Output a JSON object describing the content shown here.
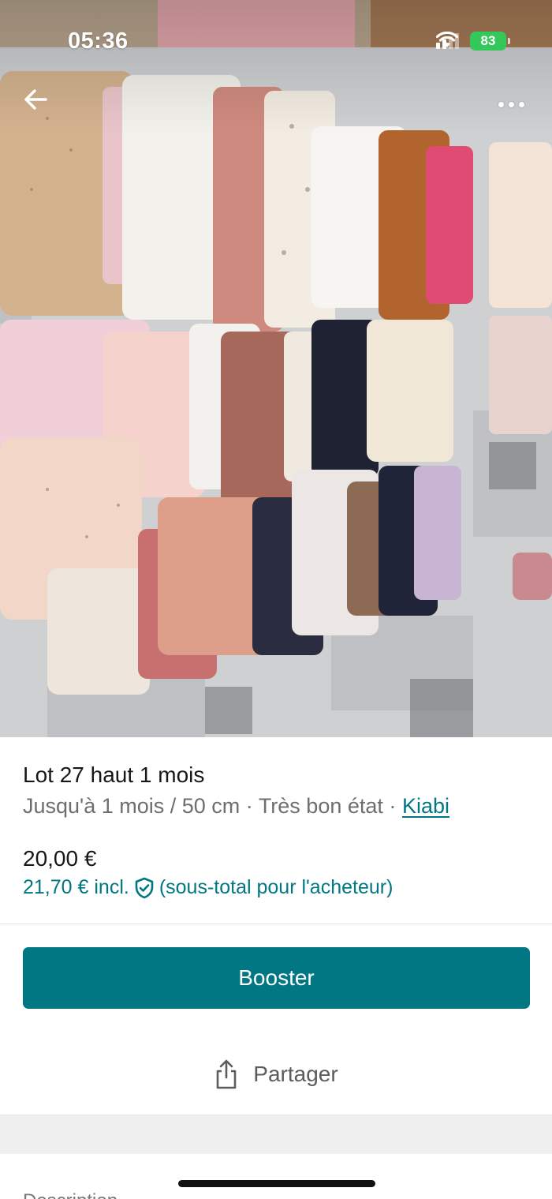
{
  "status_bar": {
    "time": "05:36",
    "battery": "83"
  },
  "nav": {
    "back_icon": "arrow-left-icon",
    "more_icon": "more-horizontal-icon"
  },
  "listing": {
    "title": "Lot 27 haut 1 mois",
    "size": "Jusqu'à 1 mois / 50 cm",
    "separator": "·",
    "condition": "Très bon état",
    "brand": "Kiabi",
    "price": "20,00 €",
    "buyer_price": "21,70 € incl.",
    "buyer_price_note": "(sous-total pour l'acheteur)"
  },
  "actions": {
    "booster_label": "Booster",
    "share_label": "Partager"
  },
  "section": {
    "description_label": "Description"
  },
  "colors": {
    "accent": "#007782",
    "battery": "#34c759"
  }
}
